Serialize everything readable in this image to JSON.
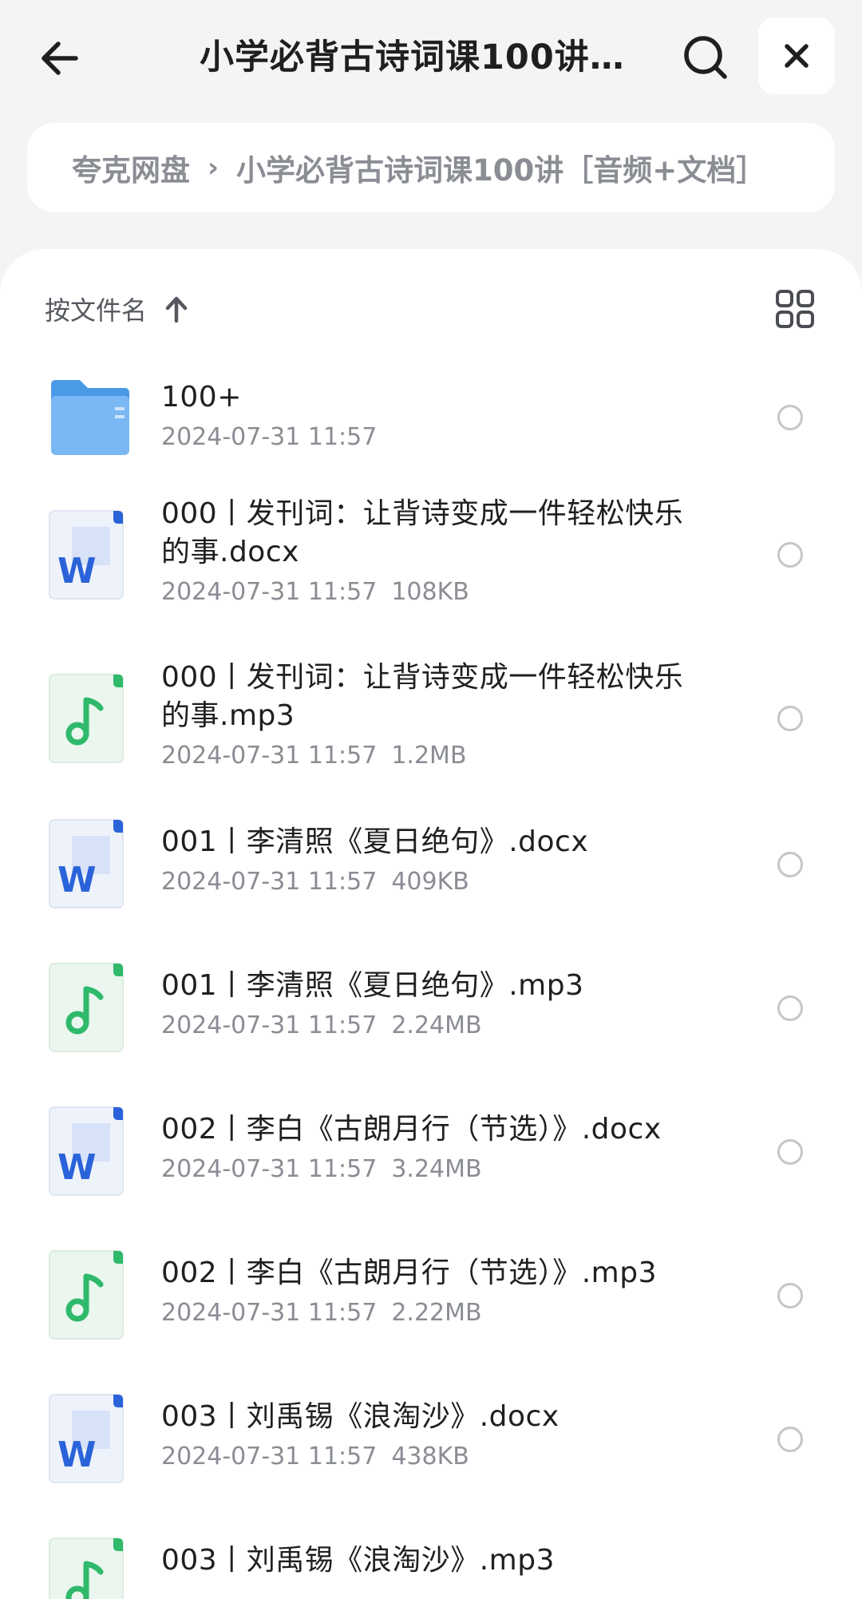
{
  "header": {
    "title": "小学必背古诗词课100讲［音频+文档］",
    "back_icon": "back-arrow-icon",
    "search_icon": "search-icon",
    "close_icon": "close-icon"
  },
  "breadcrumb": {
    "root": "夸克网盘",
    "separator": "›",
    "current": "小学必背古诗词课100讲［音频+文档］"
  },
  "toolbar": {
    "sort_label": "按文件名",
    "sort_icon": "arrow-up-icon",
    "view_icon": "grid-view-icon"
  },
  "colors": {
    "folder": "#5aa8f0",
    "word": "#2a63d9",
    "audio": "#2fb96b",
    "text_secondary": "#8a8d93"
  },
  "files": [
    {
      "type": "folder",
      "name": "100+",
      "date": "2024-07-31 11:57",
      "size": ""
    },
    {
      "type": "docx",
      "name": "000丨发刊词：让背诗变成一件轻松快乐的事.docx",
      "date": "2024-07-31 11:57",
      "size": "108KB"
    },
    {
      "type": "mp3",
      "name": "000丨发刊词：让背诗变成一件轻松快乐的事.mp3",
      "date": "2024-07-31 11:57",
      "size": "1.2MB"
    },
    {
      "type": "docx",
      "name": "001丨李清照《夏日绝句》.docx",
      "date": "2024-07-31 11:57",
      "size": "409KB"
    },
    {
      "type": "mp3",
      "name": "001丨李清照《夏日绝句》.mp3",
      "date": "2024-07-31 11:57",
      "size": "2.24MB"
    },
    {
      "type": "docx",
      "name": "002丨李白《古朗月行（节选）》.docx",
      "date": "2024-07-31 11:57",
      "size": "3.24MB"
    },
    {
      "type": "mp3",
      "name": "002丨李白《古朗月行（节选）》.mp3",
      "date": "2024-07-31 11:57",
      "size": "2.22MB"
    },
    {
      "type": "docx",
      "name": "003丨刘禹锡《浪淘沙》.docx",
      "date": "2024-07-31 11:57",
      "size": "438KB"
    },
    {
      "type": "mp3",
      "name": "003丨刘禹锡《浪淘沙》.mp3",
      "date": "",
      "size": ""
    }
  ]
}
